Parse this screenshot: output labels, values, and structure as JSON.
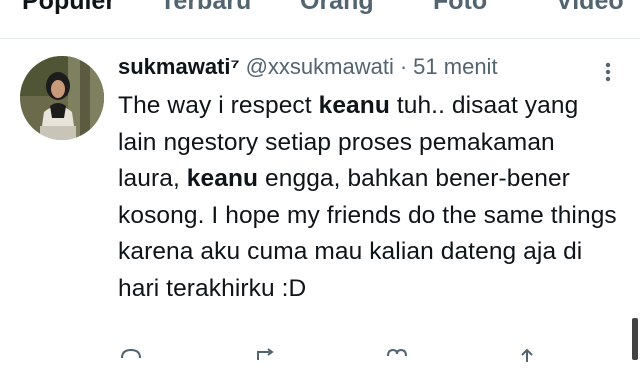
{
  "tabs": [
    {
      "label": "Populer",
      "active": true
    },
    {
      "label": "Terbaru",
      "active": false
    },
    {
      "label": "Orang",
      "active": false
    },
    {
      "label": "Foto",
      "active": false
    },
    {
      "label": "Video",
      "active": false
    }
  ],
  "tweet": {
    "display_name": "sukmawati⁷",
    "handle": "@xxsukmawati",
    "separator": "·",
    "time": "51 menit",
    "text": {
      "l1a": "The way i respect ",
      "l1b": "keanu",
      "l1c": " tuh.. disaat yang lain ngestory setiap proses pemakaman laura, ",
      "l2b": "keanu",
      "l2c": " engga, bahkan bener-bener kosong. I hope my friends do the same things karena aku cuma mau kalian dateng aja di hari terakhirku :D"
    },
    "avatar_icon": "avatar-photo",
    "more_icon": "more-vertical-icon"
  },
  "colors": {
    "text": "#0f1419",
    "secondary": "#536471",
    "divider": "#e6ecf0"
  }
}
